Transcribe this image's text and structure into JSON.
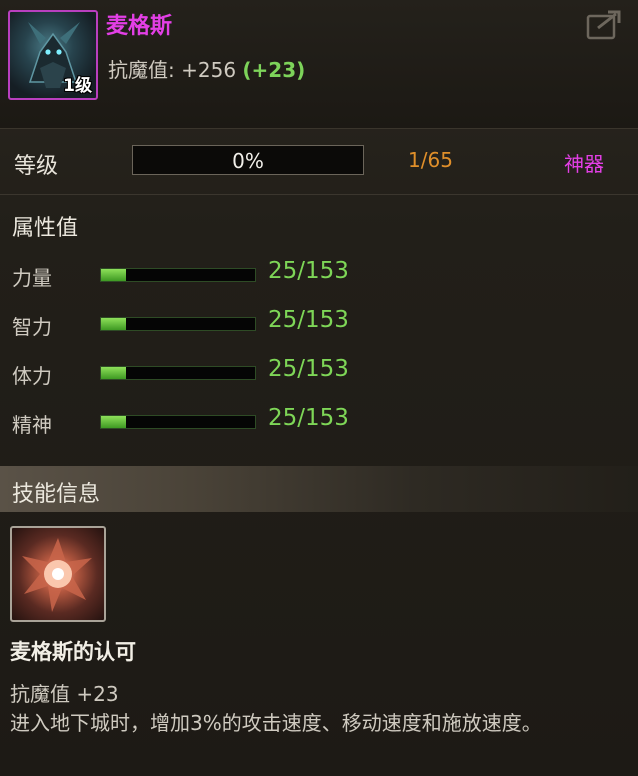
{
  "item": {
    "name": "麦格斯",
    "level_badge": "1级",
    "stat_label": "抗魔值:",
    "stat_value": "+256",
    "stat_bonus": "(+23)"
  },
  "level": {
    "label": "等级",
    "progress_text": "0%",
    "progress_fraction": 0,
    "count": "1/65",
    "rarity": "神器"
  },
  "attributes": {
    "title": "属性值",
    "items": [
      {
        "name": "力量",
        "value": "25/153",
        "fraction": 0.163
      },
      {
        "name": "智力",
        "value": "25/153",
        "fraction": 0.163
      },
      {
        "name": "体力",
        "value": "25/153",
        "fraction": 0.163
      },
      {
        "name": "精神",
        "value": "25/153",
        "fraction": 0.163
      }
    ]
  },
  "skill": {
    "title": "技能信息",
    "name": "麦格斯的认可",
    "stat": "抗魔值 +23",
    "description": "进入地下城时，增加3%的攻击速度、移动速度和施放速度。"
  },
  "colors": {
    "rarity": "#e33fe6",
    "bonus": "#7dd35a",
    "count": "#e08f2a",
    "bar_fill": "#4ea02d"
  },
  "icons": {
    "share": "share-icon",
    "portrait": "armored-knight-portrait",
    "skill": "fire-burst-skill-icon"
  }
}
